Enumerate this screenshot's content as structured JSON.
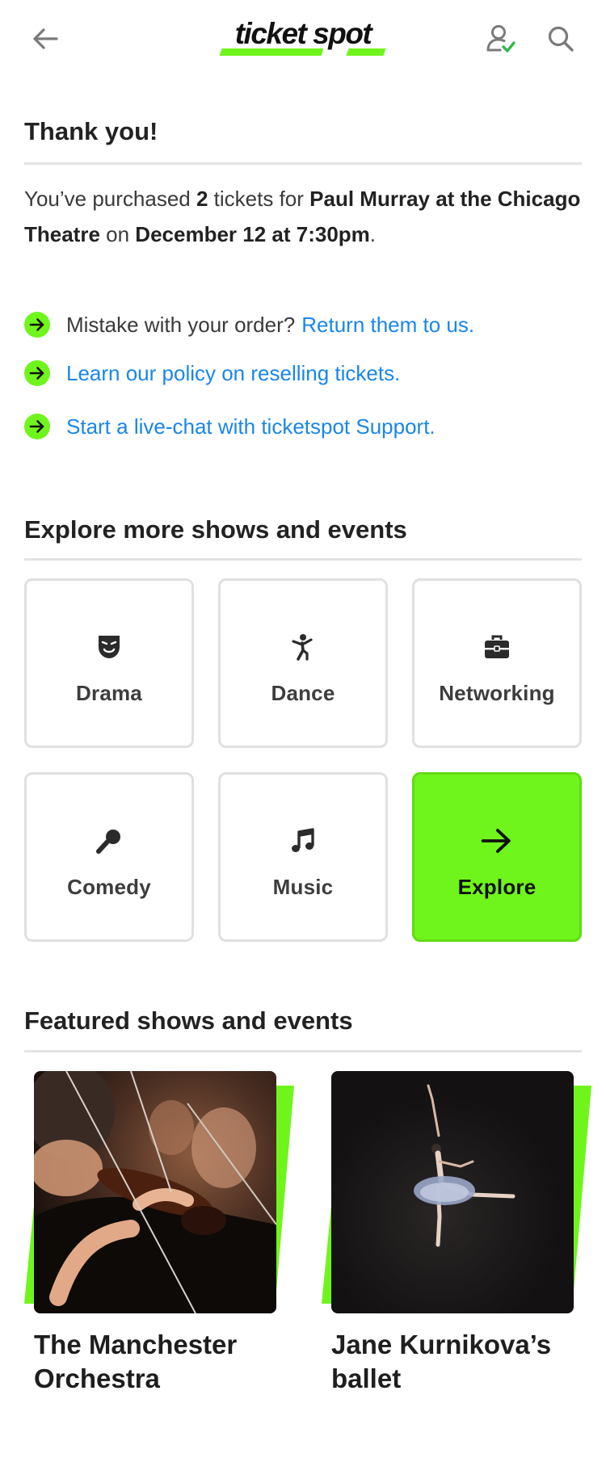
{
  "header": {
    "logo_text": "ticket spot",
    "back_icon": "arrow-left-icon",
    "account_icon": "user-check-icon",
    "search_icon": "search-icon"
  },
  "confirmation": {
    "title": "Thank you!",
    "text_1": "You’ve purchased ",
    "ticket_count": "2",
    "text_2": " tickets for ",
    "event": "Paul Murray at the Chicago Theatre",
    "text_3": " on ",
    "date": "December 12 at 7:30pm",
    "text_4": "."
  },
  "help_links": [
    {
      "prefix": "Mistake with your order?",
      "link": "Return them to us.",
      "icon": "arrow-right-icon"
    },
    {
      "prefix": "",
      "link": "Learn our policy on reselling tickets.",
      "icon": "arrow-right-icon"
    },
    {
      "prefix": "",
      "link": "Start a live-chat with ticketspot Support.",
      "icon": "arrow-right-icon"
    }
  ],
  "explore": {
    "title": "Explore more shows and events",
    "categories": [
      {
        "label": "Drama",
        "icon": "theater-mask-icon"
      },
      {
        "label": "Dance",
        "icon": "dancer-icon"
      },
      {
        "label": "Networking",
        "icon": "briefcase-icon"
      },
      {
        "label": "Comedy",
        "icon": "microphone-icon"
      },
      {
        "label": "Music",
        "icon": "music-note-icon"
      },
      {
        "label": "Explore",
        "icon": "arrow-right-icon"
      }
    ]
  },
  "featured": {
    "title": "Featured shows and events",
    "items": [
      {
        "title": "The Manchester Orchestra",
        "image": "orchestra-violinists-photo"
      },
      {
        "title": "Jane Kurnikova’s ballet",
        "image": "ballet-dancer-photo"
      }
    ]
  },
  "colors": {
    "accent": "#70f51c",
    "link": "#1a86e8",
    "text": "#2b2b2b",
    "divider": "#e3e3e3"
  }
}
